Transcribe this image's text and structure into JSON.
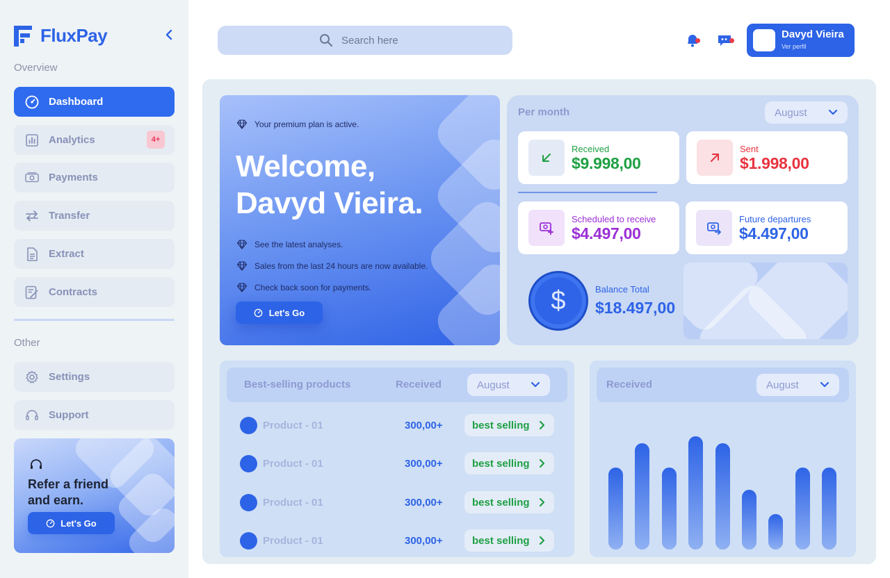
{
  "brand": {
    "name": "FluxPay",
    "accent": "#2d63e6"
  },
  "sidebar": {
    "overview_label": "Overview",
    "other_label": "Other",
    "items": [
      {
        "label": "Dashboard",
        "icon": "speedometer-icon",
        "active": true
      },
      {
        "label": "Analytics",
        "icon": "bar-chart-icon",
        "badge": "4+"
      },
      {
        "label": "Payments",
        "icon": "banknote-icon"
      },
      {
        "label": "Transfer",
        "icon": "swap-arrows-icon"
      },
      {
        "label": "Extract",
        "icon": "document-icon"
      },
      {
        "label": "Contracts",
        "icon": "contract-edit-icon"
      }
    ],
    "other_items": [
      {
        "label": "Settings",
        "icon": "gear-icon"
      },
      {
        "label": "Support",
        "icon": "headset-icon"
      }
    ],
    "refer": {
      "title": "Refer a friend and earn.",
      "button": "Let's Go"
    }
  },
  "header": {
    "search_placeholder": "Search here",
    "user": {
      "name": "Davyd Vieira",
      "subtitle": "Ver perfil"
    }
  },
  "hero": {
    "plan_text": "Your premium plan is active.",
    "title_line1": "Welcome,",
    "title_line2": "Davyd Vieira.",
    "bullets": [
      "See the latest analyses.",
      "Sales from the last 24 hours are now available.",
      "Check back soon for payments."
    ],
    "button": "Let's Go"
  },
  "per_month": {
    "label": "Per month",
    "month": "August",
    "received": {
      "label": "Received",
      "value": "$9.998,00",
      "color": "#1ea043"
    },
    "sent": {
      "label": "Sent",
      "value": "$1.998,00",
      "color": "#e8333f"
    },
    "scheduled": {
      "label": "Scheduled to receive",
      "value": "$4.497,00",
      "color": "#9b2fd6"
    },
    "future": {
      "label": "Future departures",
      "value": "$4.497,00",
      "color": "#2d63e6"
    },
    "balance": {
      "label": "Balance Total",
      "value": "$18.497,00",
      "symbol": "$"
    }
  },
  "products": {
    "col1": "Best-selling products",
    "col2": "Received",
    "month": "August",
    "rows": [
      {
        "name": "Product - 01",
        "value": "300,00+",
        "tag": "best selling"
      },
      {
        "name": "Product - 01",
        "value": "300,00+",
        "tag": "best selling"
      },
      {
        "name": "Product - 01",
        "value": "300,00+",
        "tag": "best selling"
      },
      {
        "name": "Product - 01",
        "value": "300,00+",
        "tag": "best selling"
      }
    ]
  },
  "received_chart": {
    "title": "Received",
    "month": "August"
  },
  "chart_data": {
    "type": "bar",
    "categories": [
      "",
      "",
      "",
      "",
      "",
      "",
      "",
      "",
      ""
    ],
    "values": [
      118,
      153,
      118,
      163,
      153,
      86,
      51,
      118,
      118
    ],
    "ylim": [
      0,
      165
    ],
    "grid": false,
    "legend": "none",
    "title": "Received",
    "xlabel": "",
    "ylabel": ""
  }
}
